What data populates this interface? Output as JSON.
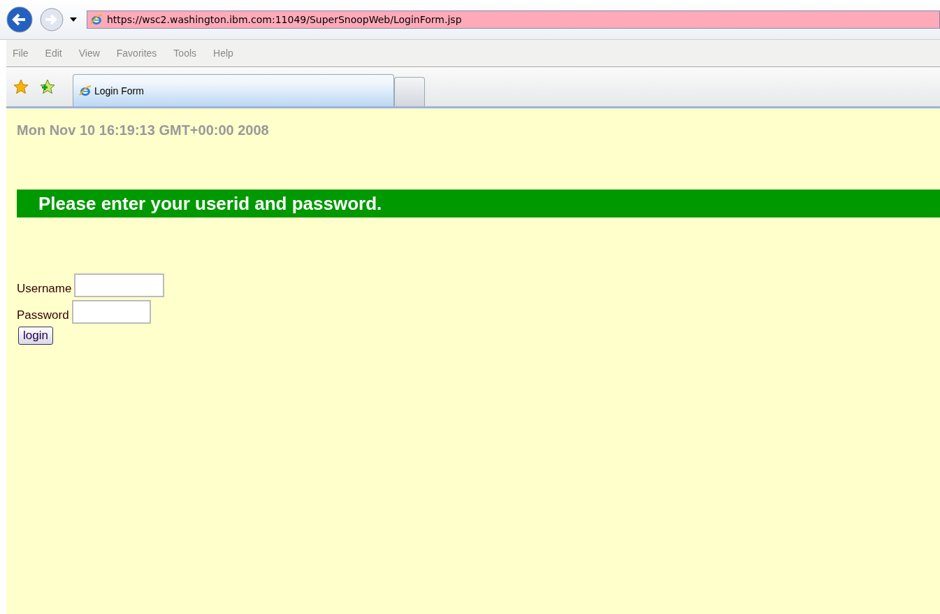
{
  "address_bar": {
    "url": "https://wsc2.washington.ibm.com:11049/SuperSnoopWeb/LoginForm.jsp"
  },
  "menu": [
    "File",
    "Edit",
    "View",
    "Favorites",
    "Tools",
    "Help"
  ],
  "tabs": [
    {
      "label": "Login Form",
      "selected": true
    }
  ],
  "page": {
    "timestamp": "Mon Nov 10 16:19:13 GMT+00:00 2008",
    "banner": "Please enter your userid and password.",
    "fields": [
      {
        "label": "Username"
      },
      {
        "label": "Password"
      }
    ],
    "button": "login"
  }
}
